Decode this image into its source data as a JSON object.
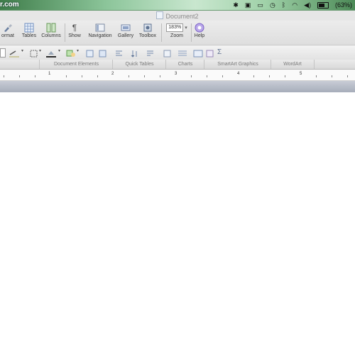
{
  "menubar": {
    "site_text": "r.com",
    "battery": "(63%)"
  },
  "window": {
    "title": "Document2"
  },
  "toolbar": {
    "format": "ormat",
    "tables": "Tables",
    "columns": "Columns",
    "show": "Show",
    "navigation": "Navigation",
    "gallery": "Gallery",
    "toolbox": "Toolbox",
    "zoom_value": "183%",
    "zoom_label": "Zoom",
    "help": "Help"
  },
  "ribbon": {
    "tabs": [
      "Document Elements",
      "Quick Tables",
      "Charts",
      "SmartArt Graphics",
      "WordArt"
    ]
  },
  "ruler": {
    "marks": [
      "1",
      "2",
      "3",
      "4",
      "5"
    ]
  },
  "colors": {
    "menubar_green": "#8cc59a",
    "help_icon": "#8a6fd1"
  }
}
